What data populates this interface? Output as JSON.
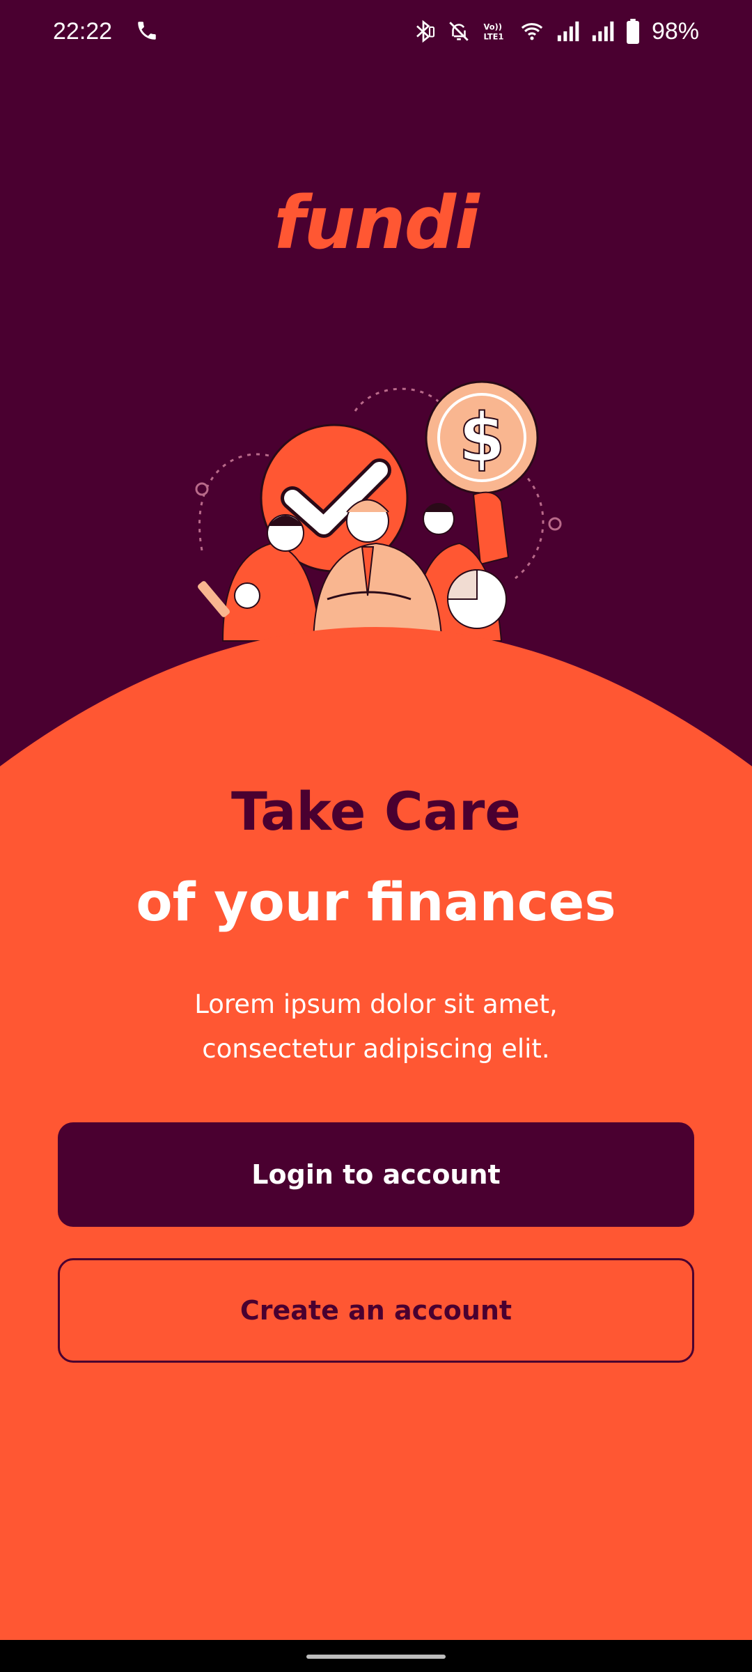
{
  "status_bar": {
    "time": "22:22",
    "battery_percent": "98%",
    "icons": [
      "phone-icon",
      "bluetooth-icon",
      "silent-icon",
      "volte-icon",
      "wifi-icon",
      "signal-icon",
      "signal-icon",
      "battery-icon"
    ]
  },
  "app": {
    "logo": "fundi"
  },
  "hero": {
    "headline_line1": "Take Care",
    "headline_line2": "of your finances",
    "subtitle": "Lorem ipsum dolor sit amet, consectetur adipiscing elit."
  },
  "actions": {
    "login_label": "Login to account",
    "create_label": "Create an account"
  },
  "colors": {
    "brand_dark": "#4a0030",
    "brand_orange": "#ff5733",
    "text_light": "#ffffff"
  }
}
